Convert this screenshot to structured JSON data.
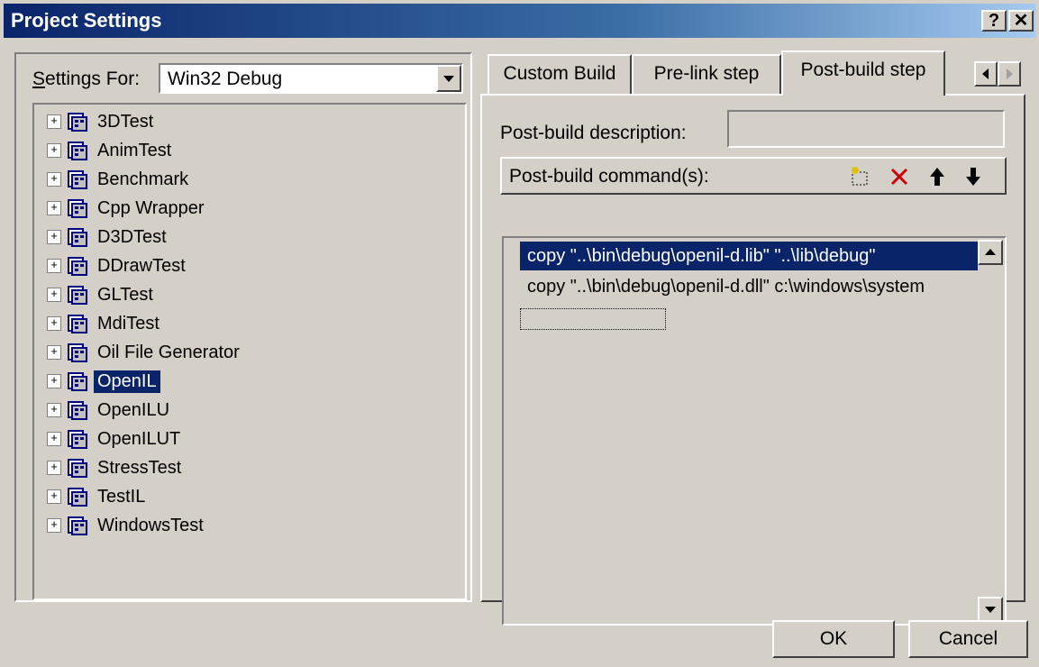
{
  "window": {
    "title": "Project Settings",
    "help_label": "?",
    "close_label": "✕"
  },
  "left": {
    "settings_label": "Settings For:",
    "settings_value": "Win32 Debug",
    "projects": [
      {
        "label": "3DTest"
      },
      {
        "label": "AnimTest"
      },
      {
        "label": "Benchmark"
      },
      {
        "label": "Cpp Wrapper"
      },
      {
        "label": "D3DTest"
      },
      {
        "label": "DDrawTest"
      },
      {
        "label": "GLTest"
      },
      {
        "label": "MdiTest"
      },
      {
        "label": "Oil File Generator"
      },
      {
        "label": "OpenIL"
      },
      {
        "label": "OpenILU"
      },
      {
        "label": "OpenILUT"
      },
      {
        "label": "StressTest"
      },
      {
        "label": "TestIL"
      },
      {
        "label": "WindowsTest"
      }
    ],
    "selected_project": "OpenIL"
  },
  "tabs": [
    {
      "label": "Custom Build"
    },
    {
      "label": "Pre-link step"
    },
    {
      "label": "Post-build step"
    }
  ],
  "active_tab": "Post-build step",
  "post_build": {
    "description_label": "Post-build description:",
    "description_value": "",
    "commands_label": "Post-build command(s):",
    "commands": [
      "copy \"..\\bin\\debug\\openil-d.lib\" \"..\\lib\\debug\"",
      "copy \"..\\bin\\debug\\openil-d.dll\" c:\\windows\\system"
    ]
  },
  "buttons": {
    "ok": "OK",
    "cancel": "Cancel"
  },
  "icons": [
    "new-command-icon",
    "delete-icon",
    "move-up-icon",
    "move-down-icon",
    "project-icon",
    "expand-icon",
    "dropdown-arrow-icon",
    "tab-scroll-left-icon",
    "tab-scroll-right-icon",
    "scroll-up-icon",
    "scroll-down-icon"
  ],
  "colors": {
    "face": "#d4d0c8",
    "selection": "#0a246a",
    "title_start": "#0a246a",
    "delete_red": "#cc0000"
  }
}
